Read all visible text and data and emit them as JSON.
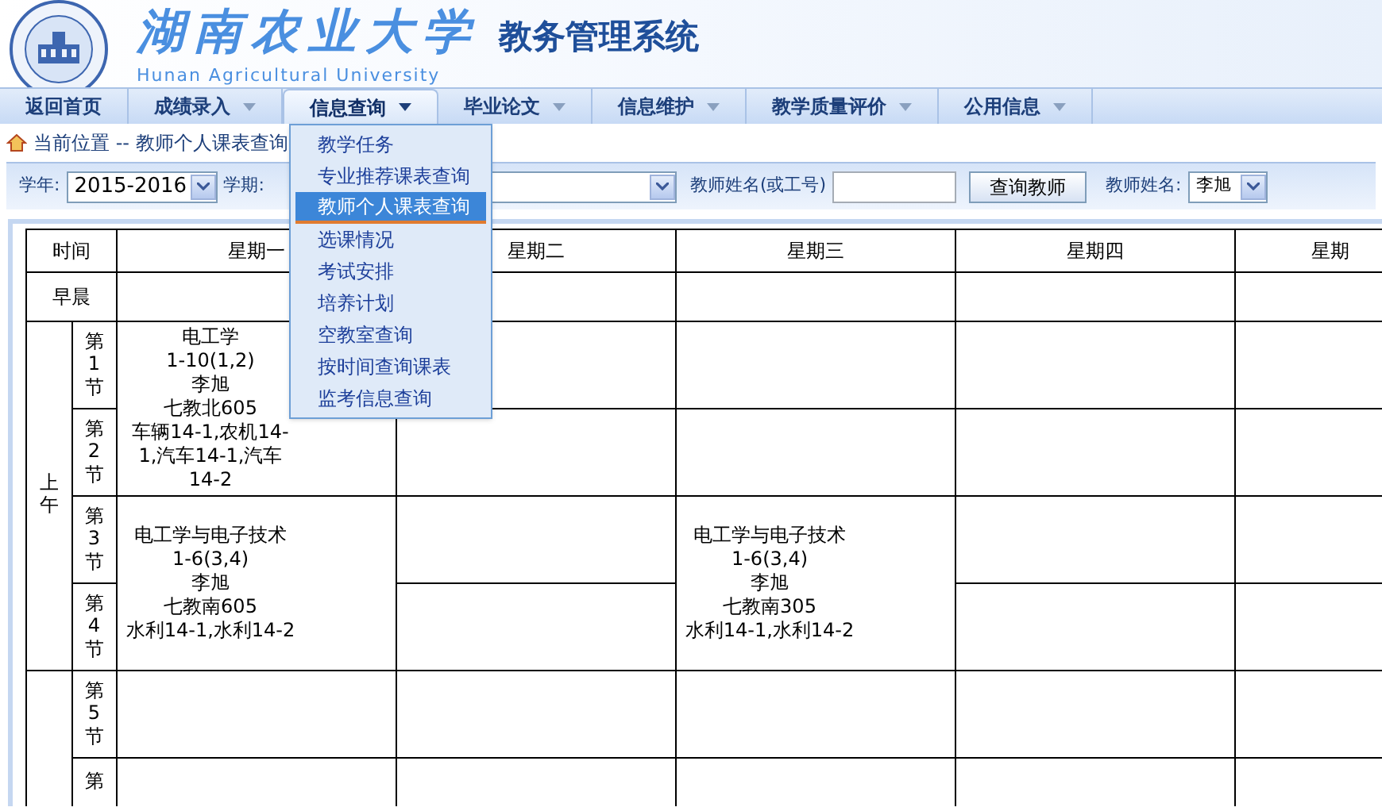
{
  "header": {
    "title": "湖南农业大学",
    "subtitle": "教务管理系统",
    "english": "Hunan Agricultural University"
  },
  "nav": [
    {
      "label": "返回首页",
      "dropdown": false,
      "selected": false
    },
    {
      "label": "成绩录入",
      "dropdown": true,
      "selected": false
    },
    {
      "label": "信息查询",
      "dropdown": true,
      "selected": true
    },
    {
      "label": "毕业论文",
      "dropdown": true,
      "selected": false
    },
    {
      "label": "信息维护",
      "dropdown": true,
      "selected": false
    },
    {
      "label": "教学质量评价",
      "dropdown": true,
      "selected": false
    },
    {
      "label": "公用信息",
      "dropdown": true,
      "selected": false
    }
  ],
  "menu": [
    {
      "label": "教学任务",
      "selected": false
    },
    {
      "label": "专业推荐课表查询",
      "selected": false
    },
    {
      "label": "教师个人课表查询",
      "selected": true
    },
    {
      "label": "选课情况",
      "selected": false
    },
    {
      "label": "考试安排",
      "selected": false
    },
    {
      "label": "培养计划",
      "selected": false
    },
    {
      "label": "空教室查询",
      "selected": false
    },
    {
      "label": "按时间查询课表",
      "selected": false
    },
    {
      "label": "监考信息查询",
      "selected": false
    }
  ],
  "breadcrumb": "当前位置 -- 教师个人课表查询",
  "filters": {
    "year_label": "学年:",
    "year": "2015-2016",
    "term_label": "学期:",
    "teacher_search_label": "教师姓名(或工号)",
    "search_button": "查询教师",
    "teacher_label": "教师姓名:",
    "teacher": "李旭"
  },
  "table": {
    "columns": [
      "时间",
      "星期一",
      "星期二",
      "星期三",
      "星期四",
      "星期"
    ],
    "morning_label": "早晨",
    "groups": [
      {
        "label": "上午",
        "periods": [
          {
            "label": "第1节",
            "cells": [
              {
                "kind": "course",
                "double": true,
                "lines": [
                  "电工学",
                  "1-10(1,2)",
                  "李旭",
                  "七教北605",
                  "车辆14-1,农机14-1,汽车14-1,汽车14-2"
                ]
              },
              {
                "kind": "empty"
              },
              {
                "kind": "empty"
              },
              {
                "kind": "empty"
              },
              {
                "kind": "empty"
              }
            ]
          },
          {
            "label": "第2节",
            "cells": [
              {
                "kind": "covered"
              },
              {
                "kind": "empty"
              },
              {
                "kind": "empty"
              },
              {
                "kind": "empty"
              },
              {
                "kind": "empty"
              }
            ]
          },
          {
            "label": "第3节",
            "cells": [
              {
                "kind": "course",
                "double": true,
                "lines": [
                  "电工学与电子技术",
                  "1-6(3,4)",
                  "李旭",
                  "七教南605",
                  "水利14-1,水利14-2"
                ]
              },
              {
                "kind": "empty"
              },
              {
                "kind": "course",
                "double": true,
                "lines": [
                  "电工学与电子技术",
                  "1-6(3,4)",
                  "李旭",
                  "七教南305",
                  "水利14-1,水利14-2"
                ]
              },
              {
                "kind": "empty"
              },
              {
                "kind": "empty"
              }
            ]
          },
          {
            "label": "第4节",
            "cells": [
              {
                "kind": "covered"
              },
              {
                "kind": "empty"
              },
              {
                "kind": "covered"
              },
              {
                "kind": "empty"
              },
              {
                "kind": "empty"
              }
            ]
          }
        ]
      },
      {
        "periods": [
          {
            "label": "第5节",
            "cells": [
              {
                "kind": "empty"
              },
              {
                "kind": "empty"
              },
              {
                "kind": "empty"
              },
              {
                "kind": "empty"
              },
              {
                "kind": "empty"
              }
            ]
          },
          {
            "label": "第",
            "cells": [
              {
                "kind": "empty"
              },
              {
                "kind": "empty"
              },
              {
                "kind": "empty"
              },
              {
                "kind": "empty"
              },
              {
                "kind": "empty"
              }
            ]
          }
        ]
      }
    ]
  }
}
